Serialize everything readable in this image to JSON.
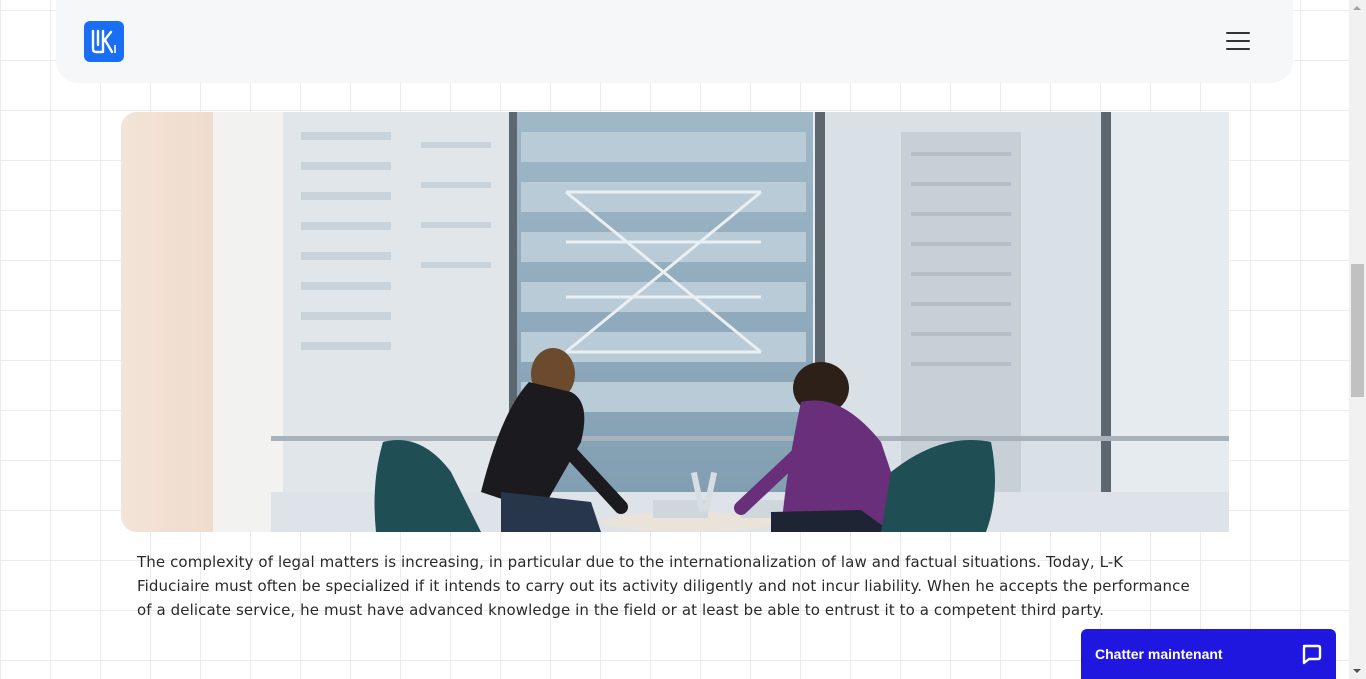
{
  "header": {
    "logo_text": "LK",
    "menu_icon": "hamburger-menu-icon"
  },
  "hero": {
    "image_description_icon": "office-meeting-photo"
  },
  "content": {
    "paragraph": "The complexity of legal matters is increasing, in particular due to the internationalization of law and factual situations. Today, L-K Fiduciaire must often be specialized if it intends to carry out its activity diligently and not incur liability. When he accepts the performance of a delicate service, he must have advanced knowledge in the field or at least be able to entrust it to a competent third party."
  },
  "chat": {
    "label": "Chatter maintenant",
    "icon": "chat-bubble-icon"
  },
  "colors": {
    "brand_blue": "#1a6df5",
    "chat_blue": "#1f17e0",
    "header_bg": "#f6f7f9"
  }
}
